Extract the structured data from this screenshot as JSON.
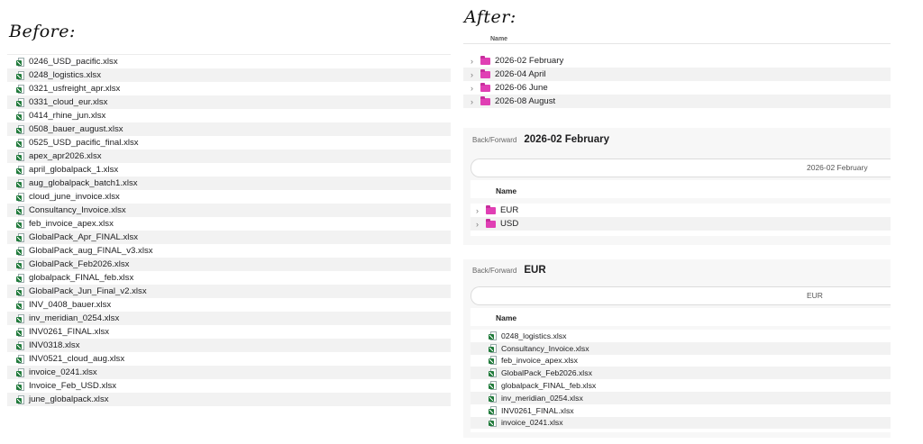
{
  "labels": {
    "before": "Before:",
    "after": "After:"
  },
  "before_files": [
    "0246_USD_pacific.xlsx",
    "0248_logistics.xlsx",
    "0321_usfreight_apr.xlsx",
    "0331_cloud_eur.xlsx",
    "0414_rhine_jun.xlsx",
    "0508_bauer_august.xlsx",
    "0525_USD_pacific_final.xlsx",
    "apex_apr2026.xlsx",
    "april_globalpack_1.xlsx",
    "aug_globalpack_batch1.xlsx",
    "cloud_june_invoice.xlsx",
    "Consultancy_Invoice.xlsx",
    "feb_invoice_apex.xlsx",
    "GlobalPack_Apr_FINAL.xlsx",
    "GlobalPack_aug_FINAL_v3.xlsx",
    "GlobalPack_Feb2026.xlsx",
    "globalpack_FINAL_feb.xlsx",
    "GlobalPack_Jun_Final_v2.xlsx",
    "INV_0408_bauer.xlsx",
    "inv_meridian_0254.xlsx",
    "INV0261_FINAL.xlsx",
    "INV0318.xlsx",
    "INV0521_cloud_aug.xlsx",
    "invoice_0241.xlsx",
    "Invoice_Feb_USD.xlsx",
    "june_globalpack.xlsx"
  ],
  "after_top": {
    "header_cut": "Name",
    "folders": [
      "2026-02 February",
      "2026-04 April",
      "2026-06 June",
      "2026-08 August"
    ]
  },
  "after_feb": {
    "back_forward": "Back/Forward",
    "title": "2026-02 February",
    "path": "2026-02 February",
    "col_name": "Name",
    "folders": [
      "EUR",
      "USD"
    ]
  },
  "after_eur": {
    "back_forward": "Back/Forward",
    "title": "EUR",
    "path": "EUR",
    "col_name": "Name",
    "files": [
      "0248_logistics.xlsx",
      "Consultancy_Invoice.xlsx",
      "feb_invoice_apex.xlsx",
      "GlobalPack_Feb2026.xlsx",
      "globalpack_FINAL_feb.xlsx",
      "inv_meridian_0254.xlsx",
      "INV0261_FINAL.xlsx",
      "invoice_0241.xlsx"
    ]
  },
  "colors": {
    "folder": "#e03fb4",
    "excel": "#1f7a3a",
    "stripe": "#f2f2f2"
  },
  "icons": {
    "file": "excel-file-icon",
    "folder": "folder-icon",
    "disclosure": "chevron-right-icon"
  }
}
